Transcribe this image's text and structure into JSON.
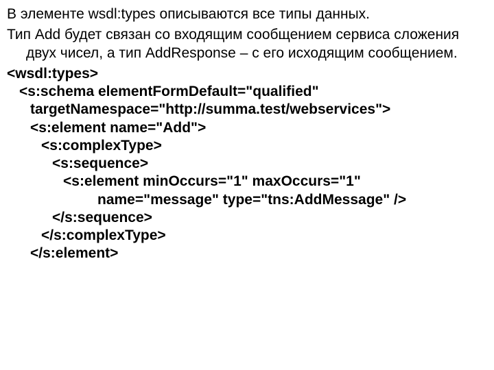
{
  "paragraphs": {
    "p1": "В элементе wsdl:types описываются все типы данных.",
    "p2": "Тип Add будет связан со входящим сообщением сервиса сложения двух чисел, а тип AddResponse – с его исходящим сообщением."
  },
  "code": {
    "l0": "<wsdl:types>",
    "l1": "<s:schema elementFormDefault=\"qualified\"",
    "l2": "targetNamespace=\"http://summa.test/webservices\">",
    "l3": "<s:element name=\"Add\">",
    "l4": "<s:complexType>",
    "l5": "<s:sequence>",
    "l6": "<s:element minOccurs=\"1\" maxOccurs=\"1\"",
    "l7": "name=\"message\" type=\"tns:AddMessage\" />",
    "l8": "</s:sequence>",
    "l9": "</s:complexType>",
    "l10": "</s:element>"
  }
}
